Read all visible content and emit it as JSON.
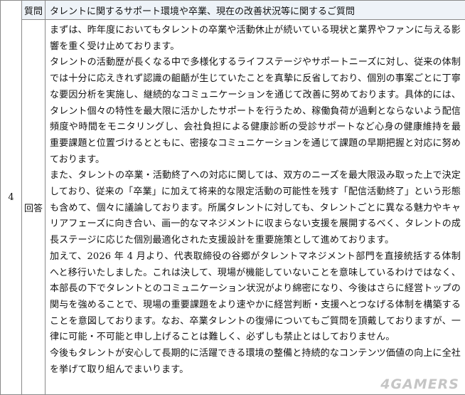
{
  "row_number": "4",
  "question": {
    "label": "質問",
    "text": "タレントに関するサポート環境や卒業、現在の改善状況等に関するご質問"
  },
  "answer": {
    "label": "回答",
    "paragraphs": [
      "まずは、昨年度においてもタレントの卒業や活動休止が続いている現状と業界やファンに与える影響を重く受け止めております。",
      "タレントの活動歴が長くなる中で多様化するライフステージやサポートニーズに対し、従来の体制では十分に応えきれず認識の齟齬が生じていたことを真摯に反省しており、個別の事案ごとに丁寧な要因分析を実施し、継続的なコミュニケーションを通じて改善に努めております。具体的には、タレント個々の特性を最大限に活かしたサポートを行うため、稼働負荷が過剰とならないよう配信頻度や時間をモニタリングし、会社負担による健康診断の受診サポートなど心身の健康維持を最重要課題と位置づけるとともに、密接なコミュニケーションを通じて課題の早期把握と対応に努めております。",
      "また、タレントの卒業・活動終了への対応に関しては、双方のニーズを最大限汲み取った上で決定しており、従来の「卒業」に加えて将来的な限定活動の可能性を残す「配信活動終了」という形態も含めて、個々に議論しております。所属タレントに対しても、タレントごとに異なる魅力やキャリアフェーズに向き合い、画一的なマネジメントに収まらない支援を展開するべく、タレントの成長ステージに応じた個別最適化された支援設計を重要施策として進めております。",
      "加えて、2026 年 4 月より、代表取締役の谷郷がタレントマネジメント部門を直接統括する体制へと移行いたしました。これは決して、現場が機能していないことを意味しているわけではなく、本部長の下でタレントとのコミュニケーション状況がより綿密になり、今後はさらに経営トップの関与を強めることで、現場の重要課題をより速やかに経営判断・支援へとつなげる体制を構築することを意図しております。なお、卒業タレントの復帰についてもご質問を頂戴しておりますが、一律に可能・不可能と申し上げることは難しく、必ずしも禁止とはしておりません。",
      "今後もタレントが安心して長期的に活躍できる環境の整備と持続的なコンテンツ価値の向上に全社を挙げて取り組んでまいります。"
    ]
  },
  "watermark": "4GAMERS"
}
